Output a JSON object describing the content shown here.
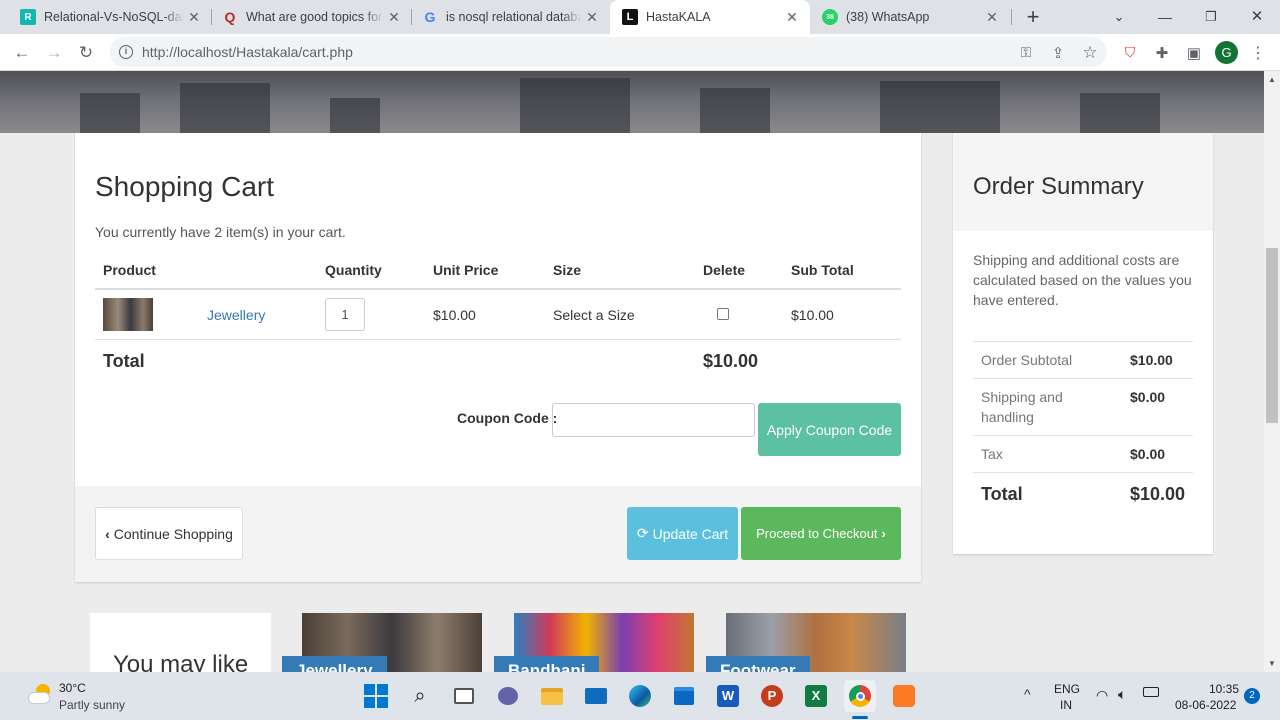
{
  "browser": {
    "tabs": [
      {
        "title": "Relational-Vs-NoSQL-data",
        "icon": "researchgate-icon"
      },
      {
        "title": "What are good topics for",
        "icon": "quora-icon"
      },
      {
        "title": "is nosql relational databa",
        "icon": "google-icon"
      },
      {
        "title": "HastaKALA",
        "icon": "hastakala-icon"
      },
      {
        "title": "(38) WhatsApp",
        "icon": "whatsapp-icon"
      }
    ],
    "url": "http://localhost/Hastakala/cart.php",
    "profile_initial": "G"
  },
  "cart": {
    "title": "Shopping Cart",
    "item_count_text": "You currently have 2 item(s) in your cart.",
    "columns": [
      "Product",
      "Quantity",
      "Unit Price",
      "Size",
      "Delete",
      "Sub Total"
    ],
    "items": [
      {
        "name": "Jewellery",
        "quantity": "1",
        "unit_price": "$10.00",
        "size": "Select a Size",
        "subtotal": "$10.00"
      }
    ],
    "total_label": "Total",
    "total_value": "$10.00",
    "coupon_label": "Coupon Code :",
    "coupon_value": "",
    "apply_coupon": "Apply Coupon Code",
    "continue_shopping": "Continue Shopping",
    "update_cart": "Update Cart",
    "checkout": "Proceed to Checkout"
  },
  "summary": {
    "title": "Order Summary",
    "note": "Shipping and additional costs are calculated based on the values you have entered.",
    "rows": [
      {
        "label": "Order Subtotal",
        "value": "$10.00"
      },
      {
        "label": "Shipping and handling",
        "value": "$0.00"
      },
      {
        "label": "Tax",
        "value": "$0.00"
      }
    ],
    "total_label": "Total",
    "total_value": "$10.00"
  },
  "you_may_like": {
    "title": "You may like",
    "cards": [
      "Jewellery",
      "Bandhani",
      "Footwear"
    ]
  },
  "taskbar": {
    "weather_temp": "30°C",
    "weather_desc": "Partly sunny",
    "lang_line1": "ENG",
    "lang_line2": "IN",
    "time": "10:35",
    "date": "08-06-2022",
    "notification_count": "2",
    "whatsapp_badge": "38"
  },
  "colors": {
    "accent_blue": "#5bc0de",
    "accent_green": "#5cb85c",
    "coupon_teal": "#5cc0a2",
    "link": "#337ab7"
  }
}
